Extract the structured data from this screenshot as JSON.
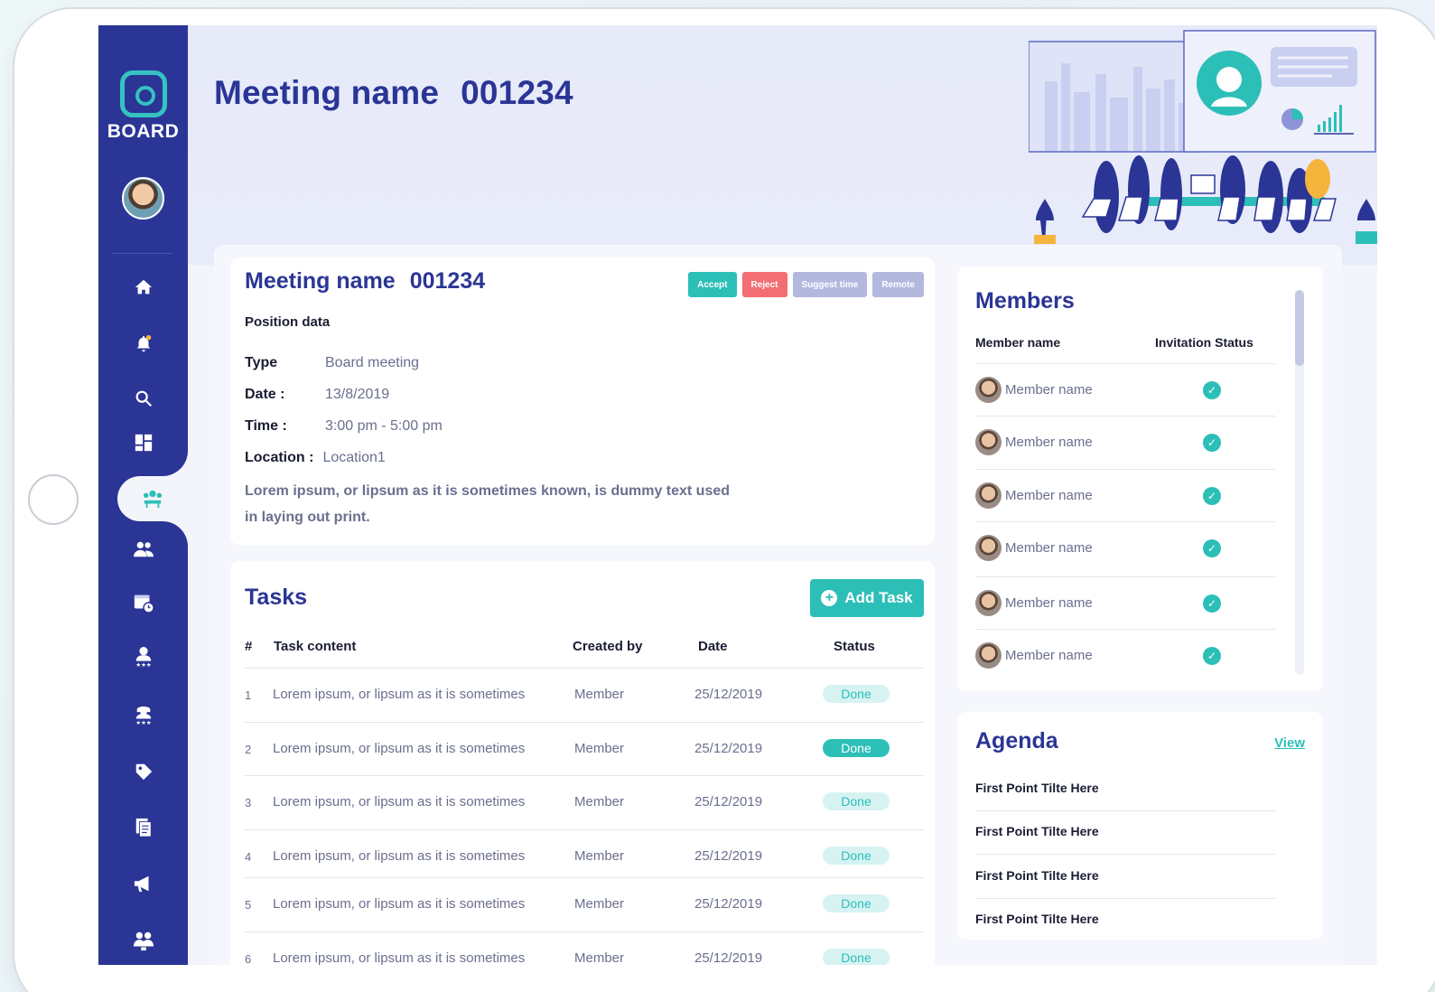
{
  "app": {
    "logo_text": "BOARD"
  },
  "sidebar": {
    "items": [
      {
        "icon": "home-icon",
        "glyph": "⌂"
      },
      {
        "icon": "notification-bell-icon",
        "glyph": "🔔"
      },
      {
        "icon": "search-icon",
        "glyph": "⌕"
      },
      {
        "icon": "dashboard-icon",
        "glyph": "▦"
      },
      {
        "icon": "meetings-icon",
        "glyph": "👥",
        "active": true
      },
      {
        "icon": "users-icon",
        "glyph": "👥"
      },
      {
        "icon": "calendar-icon",
        "glyph": "📅"
      },
      {
        "icon": "member-rating-icon",
        "glyph": "👤"
      },
      {
        "icon": "committee-icon",
        "glyph": "👤"
      },
      {
        "icon": "tag-icon",
        "glyph": "🏷"
      },
      {
        "icon": "documents-icon",
        "glyph": "📄"
      },
      {
        "icon": "announcement-icon",
        "glyph": "📣"
      },
      {
        "icon": "group-icon",
        "glyph": "👪"
      }
    ]
  },
  "header": {
    "title_name": "Meeting name",
    "title_id": "001234"
  },
  "meeting": {
    "title_name": "Meeting name",
    "title_id": "001234",
    "buttons": {
      "accept": "Accept",
      "reject": "Reject",
      "suggest": "Suggest time",
      "remote": "Remote"
    },
    "section_label": "Position data",
    "fields": {
      "type_label": "Type",
      "type_value": "Board meeting",
      "date_label": "Date :",
      "date_value": "13/8/2019",
      "time_label": "Time :",
      "time_value": "3:00 pm - 5:00 pm",
      "location_label": "Location :",
      "location_value": "Location1"
    },
    "description_line1": "Lorem ipsum, or lipsum as it is sometimes known, is dummy text used",
    "description_line2": "in laying out print."
  },
  "tasks": {
    "title": "Tasks",
    "add_label": "Add Task",
    "columns": {
      "num": "#",
      "content": "Task content",
      "created_by": "Created by",
      "date": "Date",
      "status": "Status"
    },
    "rows": [
      {
        "num": "1",
        "content": "Lorem ipsum, or lipsum as it is sometimes",
        "created_by": "Member",
        "date": "25/12/2019",
        "status": "Done"
      },
      {
        "num": "2",
        "content": "Lorem ipsum, or lipsum as it is sometimes",
        "created_by": "Member",
        "date": "25/12/2019",
        "status": "Done"
      },
      {
        "num": "3",
        "content": "Lorem ipsum, or lipsum as it is sometimes",
        "created_by": "Member",
        "date": "25/12/2019",
        "status": "Done"
      },
      {
        "num": "4",
        "content": "Lorem ipsum, or lipsum as it is sometimes",
        "created_by": "Member",
        "date": "25/12/2019",
        "status": "Done"
      },
      {
        "num": "5",
        "content": "Lorem ipsum, or lipsum as it is sometimes",
        "created_by": "Member",
        "date": "25/12/2019",
        "status": "Done"
      },
      {
        "num": "6",
        "content": "Lorem ipsum, or lipsum as it is sometimes",
        "created_by": "Member",
        "date": "25/12/2019",
        "status": "Done"
      }
    ]
  },
  "members": {
    "title": "Members",
    "col_name": "Member name",
    "col_status": "Invitation Status",
    "rows": [
      {
        "name": "Member name"
      },
      {
        "name": "Member name"
      },
      {
        "name": "Member name"
      },
      {
        "name": "Member name"
      },
      {
        "name": "Member name"
      },
      {
        "name": "Member name"
      }
    ]
  },
  "agenda": {
    "title": "Agenda",
    "view_label": "View",
    "items": [
      "First Point Tilte Here",
      "First Point Tilte Here",
      "First Point Tilte Here",
      "First Point Tilte Here"
    ]
  },
  "colors": {
    "primary": "#2a3596",
    "accent": "#2cbfb8",
    "reject": "#f26e72",
    "muted_button": "#b3b8df"
  }
}
